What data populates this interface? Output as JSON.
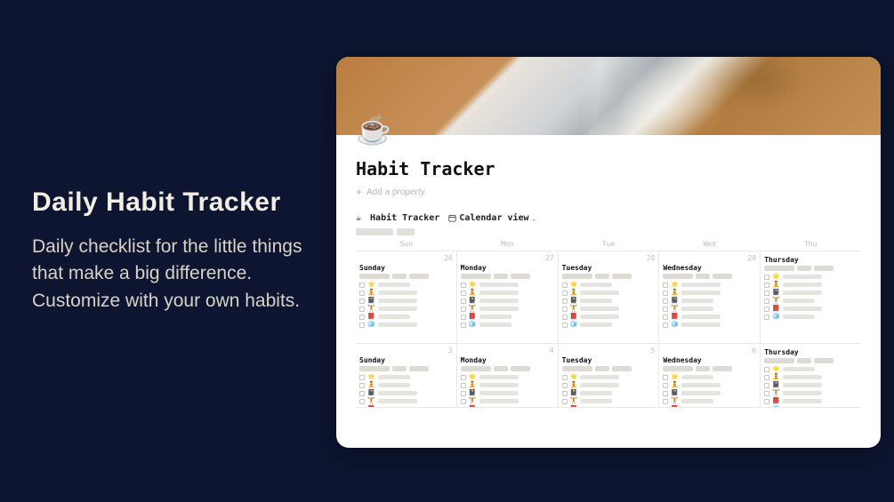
{
  "promo": {
    "title": "Daily Habit Tracker",
    "subtitle": "Daily checklist for the little things that make a big difference. Customize with your own habits."
  },
  "page": {
    "icon": "☕",
    "title": "Habit Tracker",
    "add_property_label": "Add a property"
  },
  "database": {
    "icon": "☕",
    "name": "Habit Tracker",
    "view_label": "Calendar view",
    "days_of_week": [
      "Sun",
      "Mon",
      "Tue",
      "Wed",
      "Thu"
    ],
    "weeks": [
      {
        "cells": [
          {
            "date": "26",
            "dayname": "Sunday"
          },
          {
            "date": "27",
            "dayname": "Monday"
          },
          {
            "date": "28",
            "dayname": "Tuesday"
          },
          {
            "date": "29",
            "dayname": "Wednesday"
          },
          {
            "date": "",
            "dayname": "Thursday"
          }
        ]
      },
      {
        "cells": [
          {
            "date": "3",
            "dayname": "Sunday"
          },
          {
            "date": "4",
            "dayname": "Monday"
          },
          {
            "date": "5",
            "dayname": "Tuesday"
          },
          {
            "date": "6",
            "dayname": "Wednesday"
          },
          {
            "date": "",
            "dayname": "Thursday"
          }
        ]
      }
    ],
    "habit_icons": [
      "⭐",
      "🧘",
      "📓",
      "🏋️",
      "📕",
      "🧊"
    ]
  }
}
